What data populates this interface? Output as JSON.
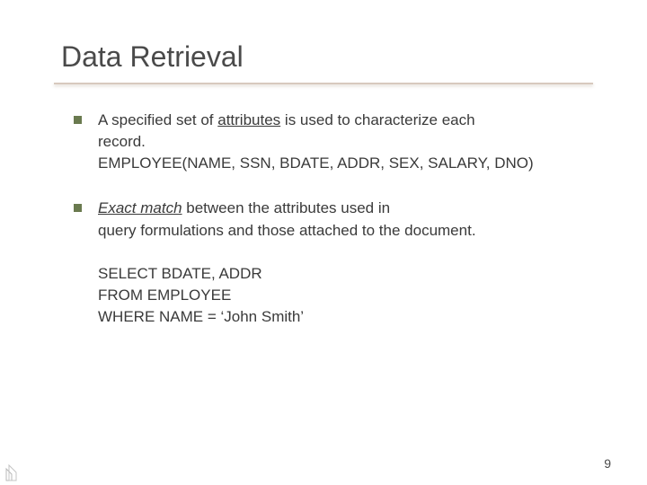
{
  "title": "Data Retrieval",
  "bullets": [
    {
      "line1_pre": "A specified set of ",
      "line1_attr": "attributes",
      "line1_post": " is used to characterize each",
      "line2": "record.",
      "line3": "EMPLOYEE(NAME, SSN, BDATE, ADDR, SEX, SALARY, DNO)"
    },
    {
      "line1_em": "Exact match",
      "line1_post": " between the attributes used in",
      "line2": "query formulations and those attached to the document.",
      "sql1": "SELECT BDATE, ADDR",
      "sql2": "FROM EMPLOYEE",
      "sql3": "WHERE NAME = ‘John Smith’"
    }
  ],
  "page_number": "9"
}
